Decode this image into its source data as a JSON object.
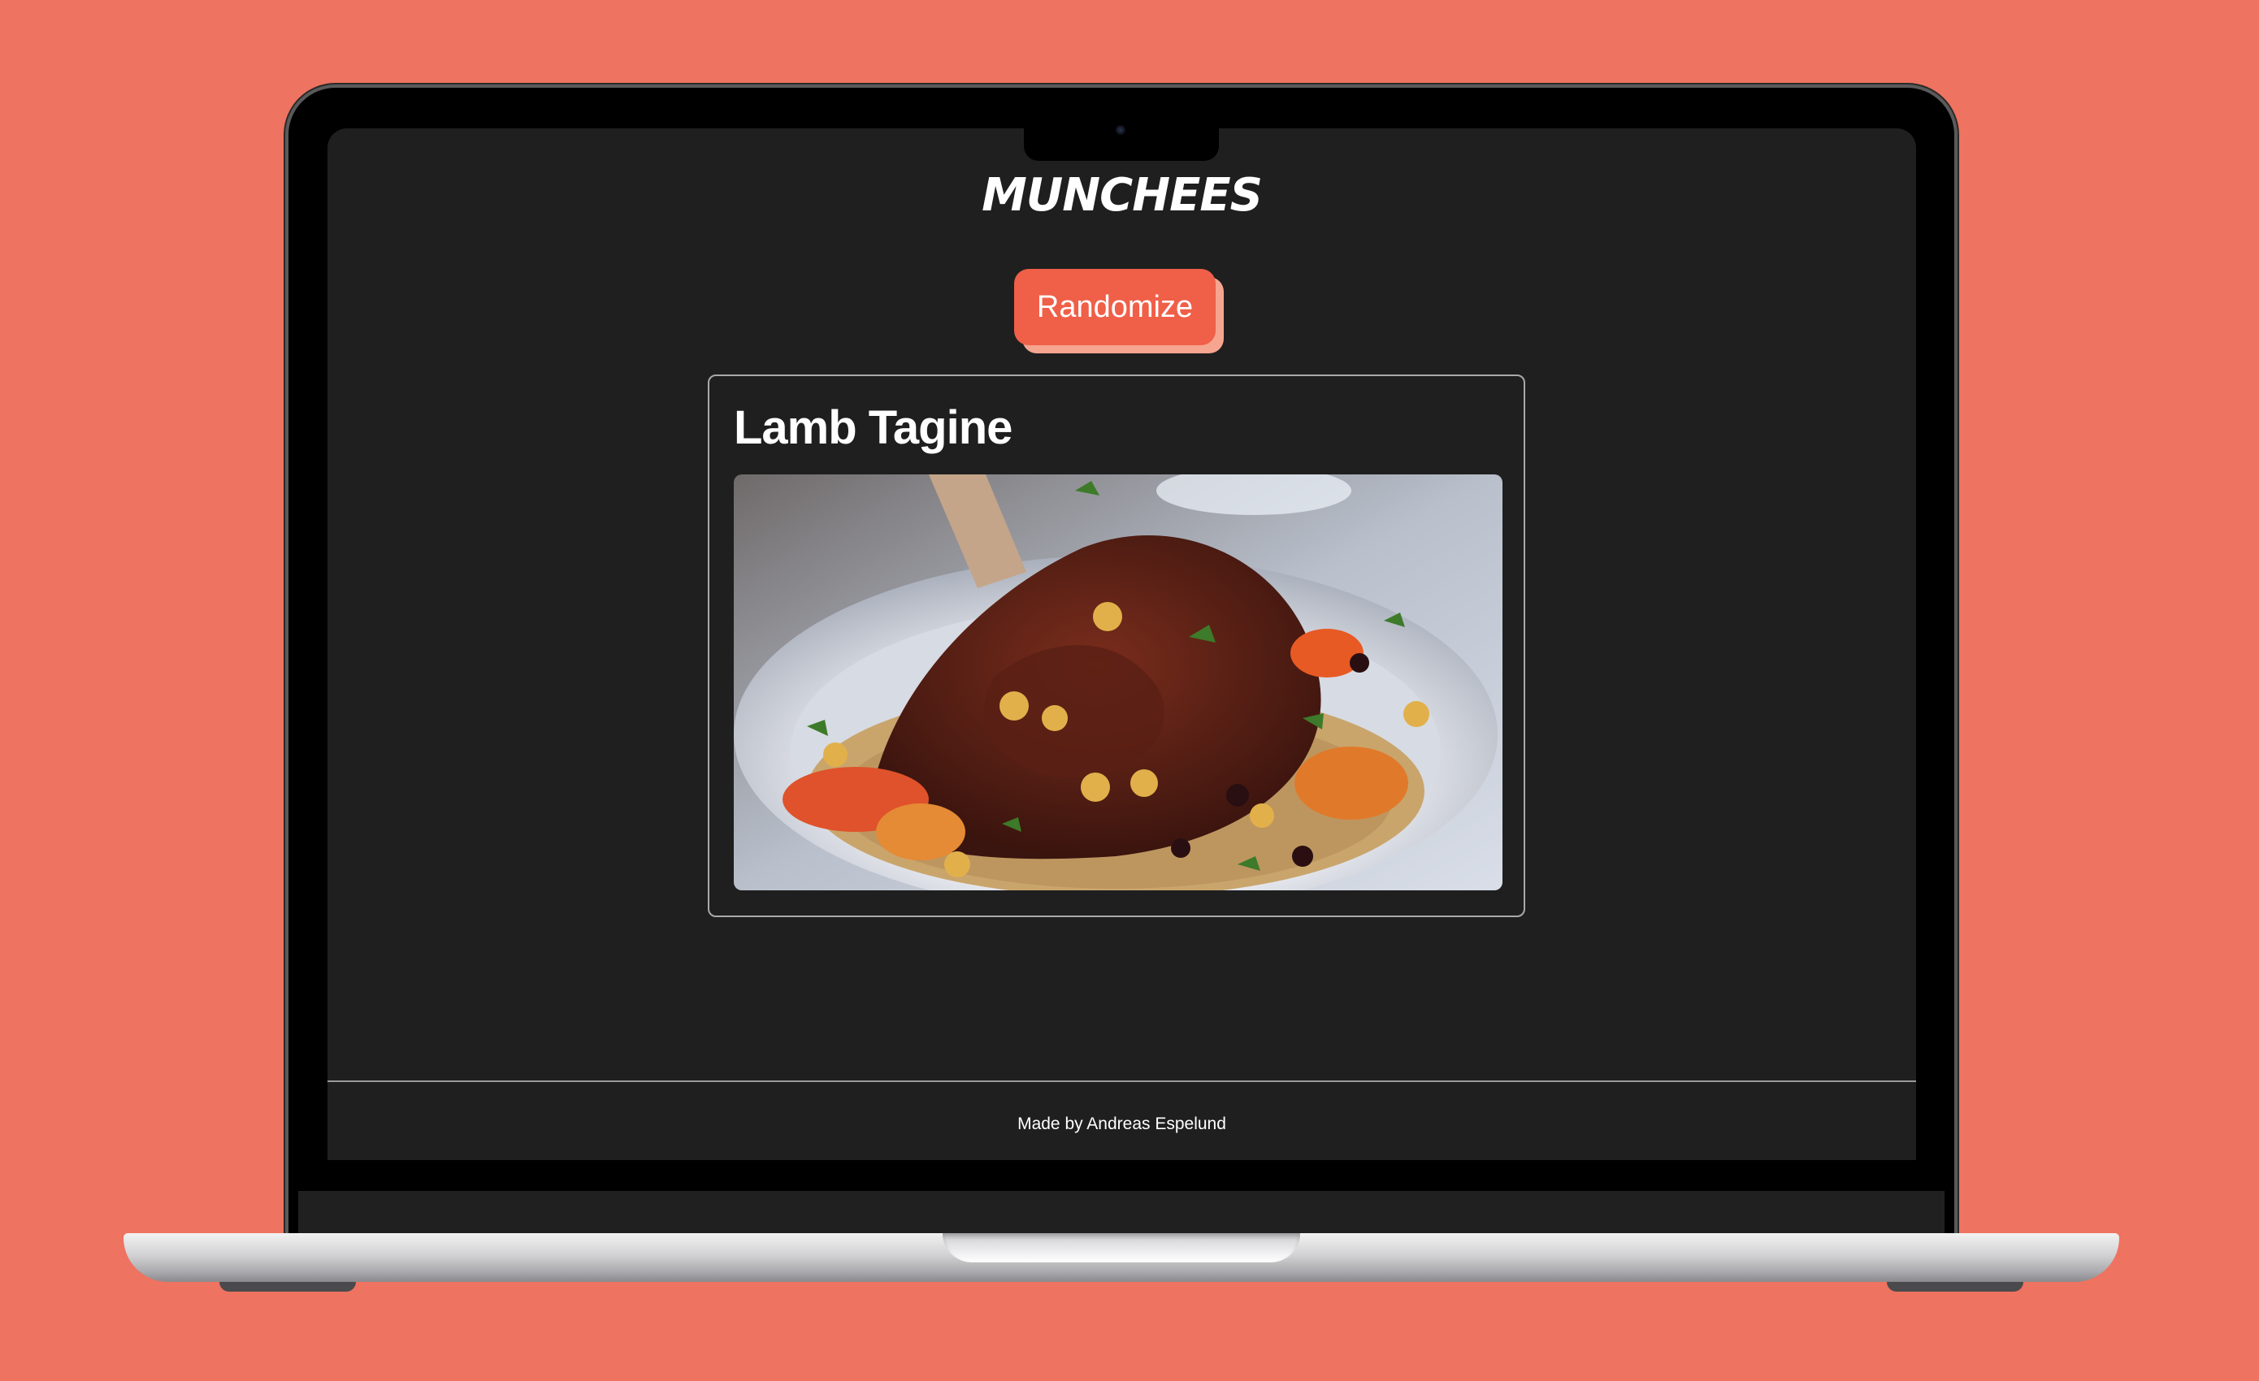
{
  "app": {
    "logo": "MUNCHEES"
  },
  "actions": {
    "randomize_label": "Randomize"
  },
  "recipe": {
    "title": "Lamb Tagine",
    "image_alt": "Lamb Tagine"
  },
  "footer": {
    "credit": "Made by Andreas Espelund"
  },
  "colors": {
    "background": "#ee7360",
    "screen": "#1f1f1f",
    "button": "#f05f48",
    "button_shadow": "#f6a590"
  }
}
